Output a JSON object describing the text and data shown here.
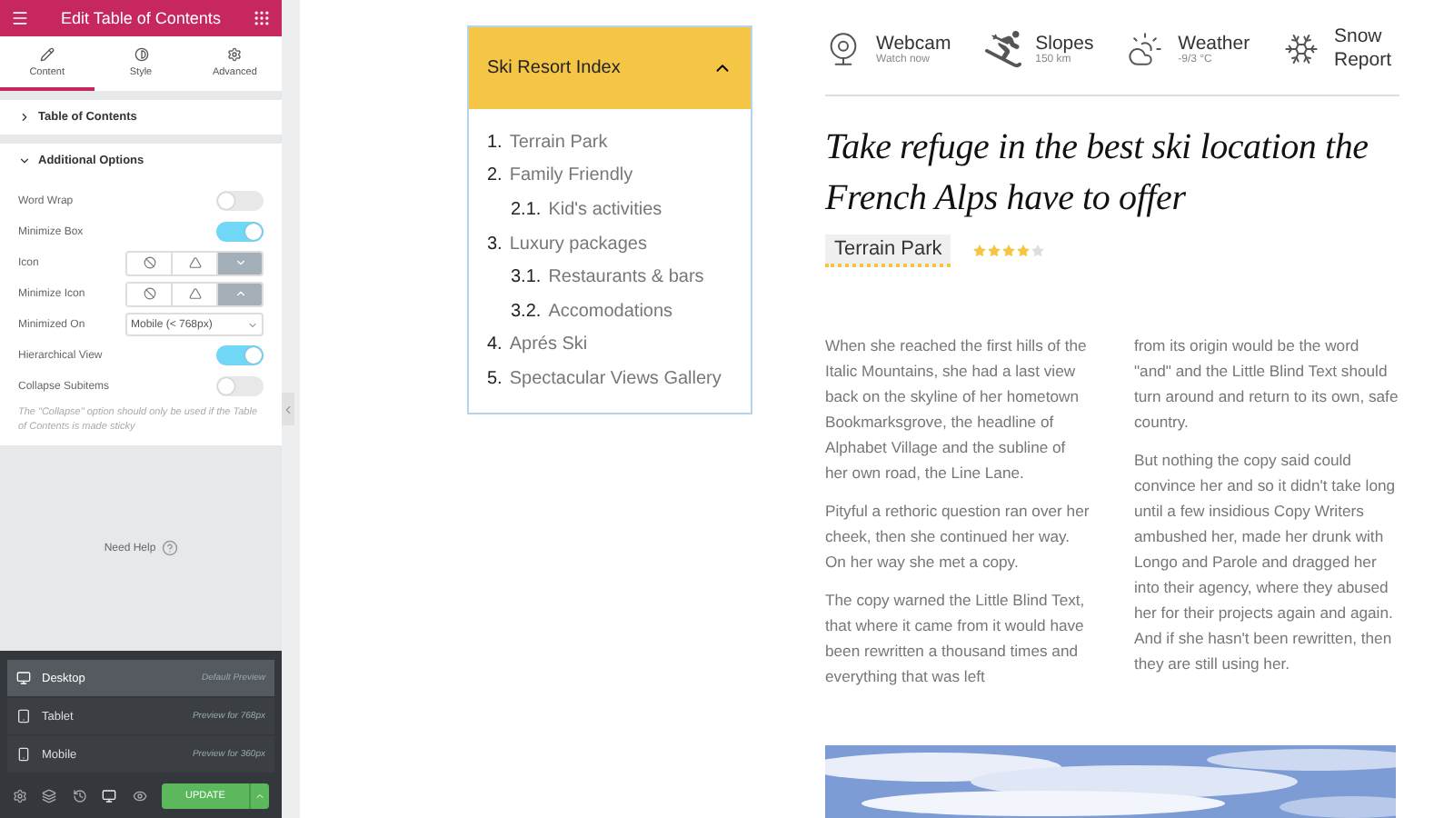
{
  "editor": {
    "title": "Edit Table of Contents",
    "tabs": [
      {
        "label": "Content",
        "selected": true
      },
      {
        "label": "Style",
        "selected": false
      },
      {
        "label": "Advanced",
        "selected": false
      }
    ],
    "sections": [
      {
        "title": "Table of Contents",
        "expanded": false
      },
      {
        "title": "Additional Options",
        "expanded": true
      }
    ],
    "controls": [
      {
        "kind": "toggle",
        "label": "Word Wrap",
        "on": false
      },
      {
        "kind": "toggle",
        "label": "Minimize Box",
        "on": true
      },
      {
        "kind": "choice",
        "label": "Icon",
        "options": [
          {
            "selected": false
          },
          {
            "selected": false
          },
          {
            "selected": true
          }
        ]
      },
      {
        "kind": "choice",
        "label": "Minimize Icon",
        "options": [
          {
            "selected": false
          },
          {
            "selected": false
          },
          {
            "selected": true
          }
        ]
      },
      {
        "kind": "select",
        "label": "Minimized On",
        "value": "Mobile (< 768px)"
      },
      {
        "kind": "toggle",
        "label": "Hierarchical View",
        "on": true
      },
      {
        "kind": "toggle",
        "label": "Collapse Subitems",
        "on": false
      }
    ],
    "note": "The \"Collapse\" option should only be used if the Table of Contents is made sticky",
    "help": "Need Help",
    "preview_menu": [
      {
        "label": "Desktop",
        "hint": "Default Preview",
        "selected": true
      },
      {
        "label": "Tablet",
        "hint": "Preview for 768px",
        "selected": false
      },
      {
        "label": "Mobile",
        "hint": "Preview for 360px",
        "selected": false
      }
    ],
    "update_button": "UPDATE"
  },
  "page": {
    "toc": {
      "title": "Ski Resort Index",
      "expanded": true,
      "items": [
        {
          "number": "1.",
          "label": "Terrain Park"
        },
        {
          "number": "2.",
          "label": "Family Friendly",
          "children": [
            {
              "number": "2.1.",
              "label": "Kid's activities"
            }
          ]
        },
        {
          "number": "3.",
          "label": "Luxury packages",
          "children": [
            {
              "number": "3.1.",
              "label": "Restaurants & bars"
            },
            {
              "number": "3.2.",
              "label": "Accomodations"
            }
          ]
        },
        {
          "number": "4.",
          "label": "Aprés Ski"
        },
        {
          "number": "5.",
          "label": "Spectacular Views Gallery"
        }
      ]
    },
    "features": [
      {
        "label": "Webcam",
        "sub": "Watch now"
      },
      {
        "label": "Slopes",
        "sub": "150 km"
      },
      {
        "label": "Weather",
        "sub": "-9/3 °C"
      },
      {
        "label": "Snow Report"
      }
    ],
    "headline": "Take refuge in the best ski location the French Alps have to offer",
    "tag": "Terrain Park",
    "stars": 4,
    "columns": [
      [
        "When she reached the first hills of the Italic Mountains, she had a last view back on the skyline of her hometown Bookmarksgrove, the headline of Alphabet Village and the subline of her own road, the Line Lane.",
        "Pityful a rethoric question ran over her cheek, then she continued her way. On her way she met a copy.",
        "The copy warned the Little Blind Text, that where it came from it would have been rewritten a thousand times and everything that was left"
      ],
      [
        "from its origin would be the word \"and\" and the Little Blind Text should turn around and return to its own, safe country.",
        "But nothing the copy said could convince her and so it didn't take long until a few insidious Copy Writers ambushed her, made her drunk with Longo and Parole and dragged her into their agency, where they abused her for their projects again and again. And if she hasn't been rewritten, then they are still using her."
      ]
    ]
  }
}
